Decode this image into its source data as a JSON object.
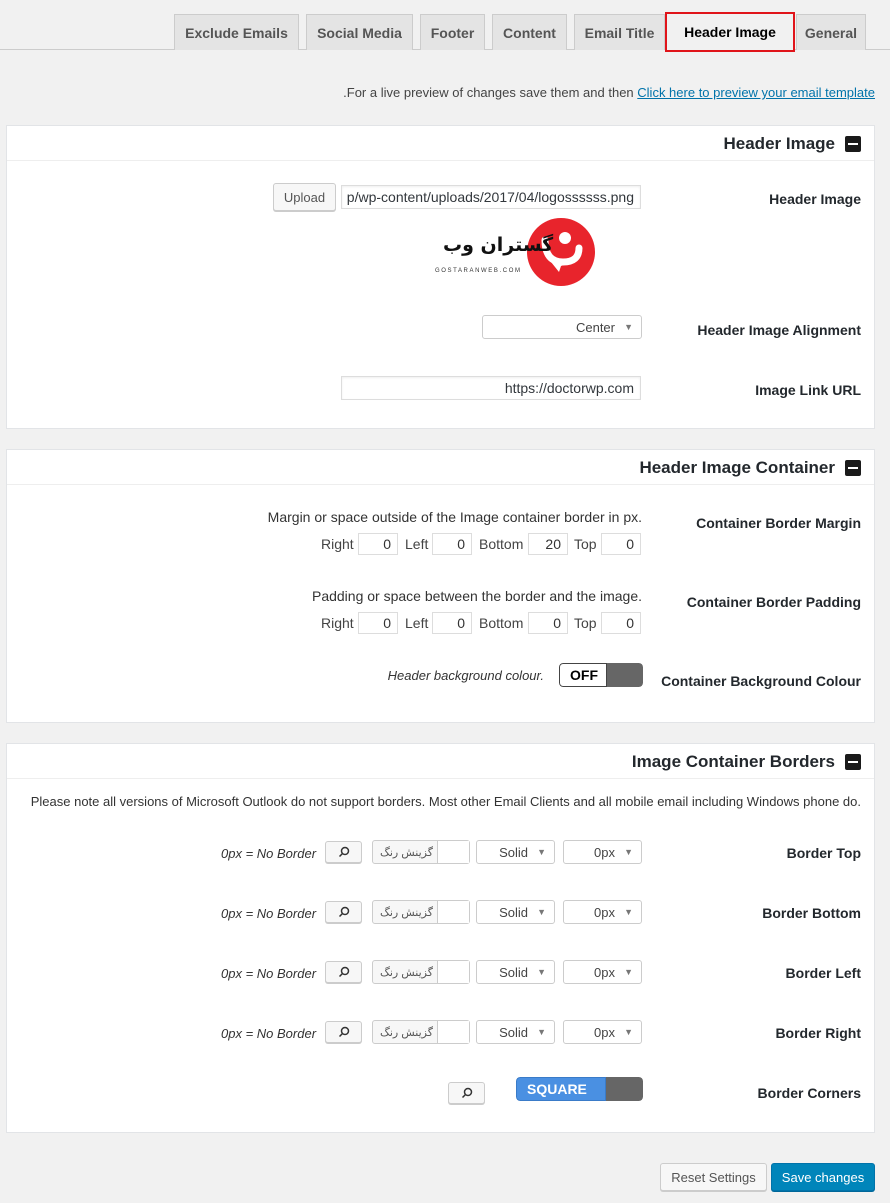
{
  "tabs": [
    {
      "label": "Exclude Emails"
    },
    {
      "label": "Social Media"
    },
    {
      "label": "Footer"
    },
    {
      "label": "Content"
    },
    {
      "label": "Email Title"
    },
    {
      "label": "Header Image"
    },
    {
      "label": "General"
    }
  ],
  "notice": {
    "text": "For a live preview of changes save them and then",
    "link": "Click here to preview your email template",
    "trail": "."
  },
  "header_image_panel": {
    "title": "Header Image",
    "image_label": "Header Image",
    "upload_button": "Upload",
    "image_url": "p/wp-content/uploads/2017/04/logossssss.png",
    "logo_text_fa": "گستران وب",
    "logo_sub": "GOSTARANWEB.COM",
    "alignment_label": "Header Image Alignment",
    "alignment_value": "Center",
    "link_label": "Image Link URL",
    "link_value": "https://doctorwp.com"
  },
  "container_panel": {
    "title": "Header Image Container",
    "margin_label": "Container Border Margin",
    "margin_desc": "Margin or space outside of the Image container border in px.",
    "margin": {
      "right": "0",
      "left": "0",
      "bottom": "20",
      "top": "0"
    },
    "padding_label": "Container Border Padding",
    "padding_desc": "Padding or space between the border and the image.",
    "padding": {
      "right": "0",
      "left": "0",
      "bottom": "0",
      "top": "0"
    },
    "side_labels": {
      "right": "Right",
      "left": "Left",
      "bottom": "Bottom",
      "top": "Top"
    },
    "bg_label": "Container Background Colour",
    "bg_toggle": "OFF",
    "bg_desc": "Header background colour."
  },
  "borders_panel": {
    "title": "Image Container Borders",
    "note": "Please note all versions of Microsoft Outlook do not support borders. Most other Email Clients and all mobile email including Windows phone do.",
    "color_pick_label": "گزینش رنگ",
    "rows": [
      {
        "label": "Border Top",
        "size": "0px",
        "style": "Solid",
        "hint": "0px = No Border"
      },
      {
        "label": "Border Bottom",
        "size": "0px",
        "style": "Solid",
        "hint": "0px = No Border"
      },
      {
        "label": "Border Left",
        "size": "0px",
        "style": "Solid",
        "hint": "0px = No Border"
      },
      {
        "label": "Border Right",
        "size": "0px",
        "style": "Solid",
        "hint": "0px = No Border"
      }
    ],
    "corners_label": "Border Corners",
    "corners_toggle": "SQUARE"
  },
  "footer": {
    "reset": "Reset Settings",
    "save": "Save changes"
  },
  "colors": {
    "accent": "#0085ba",
    "active_tab_border": "#e0141a",
    "logo_red": "#e8242c"
  }
}
